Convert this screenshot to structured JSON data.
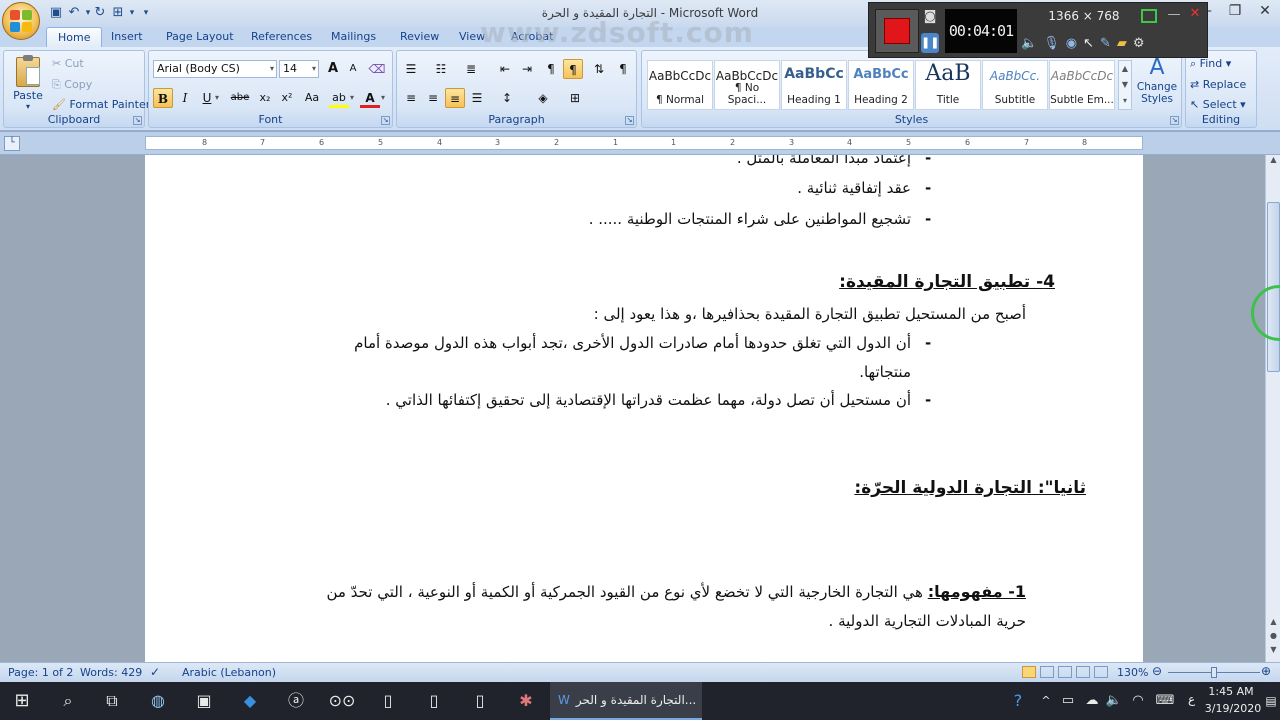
{
  "window": {
    "title": "التجارة المقيدة و الحرة - Microsoft Word",
    "minimize": "—",
    "maximize": "❐",
    "close": "✕"
  },
  "qat": {
    "undo": "↶",
    "redo": "↻"
  },
  "tabs": [
    "Home",
    "Insert",
    "Page Layout",
    "References",
    "Mailings",
    "Review",
    "View",
    "Acrobat"
  ],
  "ribbon": {
    "clipboard": {
      "label": "Clipboard",
      "paste": "Paste",
      "cut": "Cut",
      "copy": "Copy",
      "format_painter": "Format Painter"
    },
    "font": {
      "label": "Font",
      "font_name": "Arial (Body CS)",
      "font_size": "14",
      "grow": "A",
      "shrink": "A",
      "bold": "B",
      "italic": "I",
      "underline": "U",
      "strike": "abe",
      "subscript": "x₂",
      "superscript": "x²",
      "change_case": "Aa",
      "highlight": "ab",
      "font_color": "A"
    },
    "paragraph": {
      "label": "Paragraph"
    },
    "styles": {
      "label": "Styles",
      "items": [
        {
          "preview": "AaBbCcDc",
          "name": "¶ Normal"
        },
        {
          "preview": "AaBbCcDc",
          "name": "¶ No Spaci..."
        },
        {
          "preview": "AaBbCc",
          "name": "Heading 1"
        },
        {
          "preview": "AaBbCc",
          "name": "Heading 2"
        },
        {
          "preview": "AaB",
          "name": "Title"
        },
        {
          "preview": "AaBbCc.",
          "name": "Subtitle"
        },
        {
          "preview": "AaBbCcDc",
          "name": "Subtle Em..."
        }
      ],
      "change_styles": "Change Styles"
    },
    "editing": {
      "label": "Editing",
      "find": "Find",
      "replace": "Replace",
      "select": "Select"
    }
  },
  "ruler": {
    "numbers": [
      "8",
      "7",
      "6",
      "5",
      "4",
      "3",
      "2",
      "1",
      "1",
      "2",
      "3",
      "4",
      "5",
      "6",
      "7",
      "8"
    ]
  },
  "recorder": {
    "resolution": "1366 × 768",
    "timer": "00:04:01"
  },
  "watermark": "www.zdsoft.com",
  "document": {
    "bullet_top": "إعتماد مبدأ المعاملة بالمثل .",
    "bullet1": "عقد إتفاقية ثنائية .",
    "bullet2": "تشجيع المواطنين على شراء المنتجات الوطنية ..... .",
    "heading4": "4- تطبيق التجارة المقيدة:",
    "para1": "أصبح من المستحيل تطبيق التجارة المقيدة بحذافيرها ،و هذا يعود إلى :",
    "bullet3_line1": "أن الدول التي تغلق حدودها أمام صادرات الدول الأخرى ،تجد أبواب هذه الدول موصدة أمام",
    "bullet3_line2": "منتجاتها.",
    "bullet4": "أن مستحيل أن تصل دولة، مهما عظمت قدراتها الإقتصادية إلى تحقيق إكتفائها الذاتي .",
    "heading_second": "ثانيا\": التجارة الدولية الحرّة:",
    "def_label": "1- مفهومها:",
    "def_text": "هي التجارة الخارجية التي لا تخضع لأي نوع من القيود الجمركية أو الكمية أو النوعية ، التي تحدّ من",
    "def_line2": "حرية المبادلات التجارية الدولية ."
  },
  "status": {
    "page": "Page: 1 of 2",
    "words": "Words: 429",
    "language": "Arabic (Lebanon)",
    "zoom": "130%"
  },
  "taskbar": {
    "active_app": "التجارة المقيدة و الحر...",
    "time": "1:45 AM",
    "date": "3/19/2020",
    "lang": "ع"
  }
}
